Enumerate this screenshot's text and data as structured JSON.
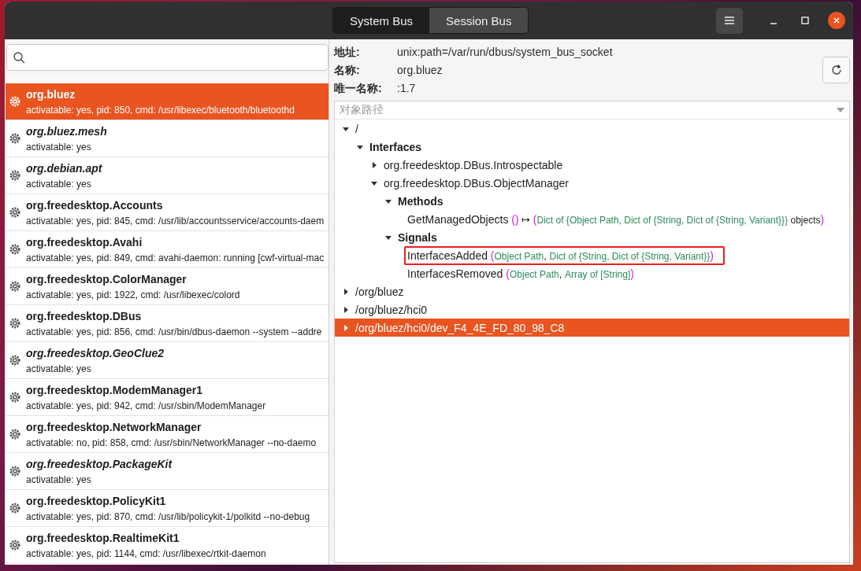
{
  "header": {
    "tabs": [
      {
        "label": "System Bus",
        "selected": true
      },
      {
        "label": "Session Bus",
        "selected": false
      }
    ]
  },
  "services": [
    {
      "name": "org.bluez",
      "detail": "activatable: yes, pid: 850, cmd: /usr/libexec/bluetooth/bluetoothd",
      "italic": false,
      "selected": true
    },
    {
      "name": "org.bluez.mesh",
      "detail": "activatable: yes",
      "italic": true,
      "selected": false
    },
    {
      "name": "org.debian.apt",
      "detail": "activatable: yes",
      "italic": true,
      "selected": false
    },
    {
      "name": "org.freedesktop.Accounts",
      "detail": "activatable: yes, pid: 845, cmd: /usr/lib/accountsservice/accounts-daem",
      "italic": false,
      "selected": false
    },
    {
      "name": "org.freedesktop.Avahi",
      "detail": "activatable: yes, pid: 849, cmd: avahi-daemon: running [cwf-virtual-mac",
      "italic": false,
      "selected": false
    },
    {
      "name": "org.freedesktop.ColorManager",
      "detail": "activatable: yes, pid: 1922, cmd: /usr/libexec/colord",
      "italic": false,
      "selected": false
    },
    {
      "name": "org.freedesktop.DBus",
      "detail": "activatable: yes, pid: 856, cmd: /usr/bin/dbus-daemon --system --addre",
      "italic": false,
      "selected": false
    },
    {
      "name": "org.freedesktop.GeoClue2",
      "detail": "activatable: yes",
      "italic": true,
      "selected": false
    },
    {
      "name": "org.freedesktop.ModemManager1",
      "detail": "activatable: yes, pid: 942, cmd: /usr/sbin/ModemManager",
      "italic": false,
      "selected": false
    },
    {
      "name": "org.freedesktop.NetworkManager",
      "detail": "activatable: no, pid: 858, cmd: /usr/sbin/NetworkManager --no-daemo",
      "italic": false,
      "selected": false
    },
    {
      "name": "org.freedesktop.PackageKit",
      "detail": "activatable: yes",
      "italic": true,
      "selected": false
    },
    {
      "name": "org.freedesktop.PolicyKit1",
      "detail": "activatable: yes, pid: 870, cmd: /usr/lib/policykit-1/polkitd --no-debug",
      "italic": false,
      "selected": false
    },
    {
      "name": "org.freedesktop.RealtimeKit1",
      "detail": "activatable: yes, pid: 1144, cmd: /usr/libexec/rtkit-daemon",
      "italic": false,
      "selected": false
    }
  ],
  "info": [
    {
      "label": "地址:",
      "value": "unix:path=/var/run/dbus/system_bus_socket"
    },
    {
      "label": "名称:",
      "value": "org.bluez"
    },
    {
      "label": "唯一名称:",
      "value": ":1.7"
    }
  ],
  "object_path": {
    "placeholder": "对象路径"
  },
  "tree": [
    {
      "label": "/",
      "bold": false,
      "expanded": true,
      "selected": false,
      "children": [
        {
          "label": "Interfaces",
          "bold": true,
          "expanded": true,
          "selected": false,
          "children": [
            {
              "label": "org.freedesktop.DBus.Introspectable",
              "bold": false,
              "expanded": false,
              "selected": false
            },
            {
              "label": "org.freedesktop.DBus.ObjectManager",
              "bold": false,
              "expanded": true,
              "selected": false,
              "children": [
                {
                  "label": "Methods",
                  "bold": true,
                  "expanded": true,
                  "selected": false,
                  "children": [
                    {
                      "kind": "member",
                      "highlighted": false,
                      "tokens": [
                        {
                          "kind": "name",
                          "text": "GetManagedObjects "
                        },
                        {
                          "kind": "paren",
                          "text": "()"
                        },
                        {
                          "kind": "plain",
                          "text": " ↦ "
                        },
                        {
                          "kind": "paren",
                          "text": "("
                        },
                        {
                          "kind": "type",
                          "text": "Dict of {Object Path, Dict of {String, Dict of {String, Variant}}}"
                        },
                        {
                          "kind": "arg",
                          "text": " objects"
                        },
                        {
                          "kind": "paren",
                          "text": ")"
                        }
                      ]
                    }
                  ]
                },
                {
                  "label": "Signals",
                  "bold": true,
                  "expanded": true,
                  "selected": false,
                  "children": [
                    {
                      "kind": "member",
                      "highlighted": true,
                      "tokens": [
                        {
                          "kind": "name",
                          "text": "InterfacesAdded "
                        },
                        {
                          "kind": "paren",
                          "text": "("
                        },
                        {
                          "kind": "type",
                          "text": "Object Path"
                        },
                        {
                          "kind": "plain",
                          "text": ", "
                        },
                        {
                          "kind": "type",
                          "text": "Dict of {String, Dict of {String, Variant}}"
                        },
                        {
                          "kind": "paren",
                          "text": ")"
                        }
                      ]
                    },
                    {
                      "kind": "member",
                      "highlighted": false,
                      "tokens": [
                        {
                          "kind": "name",
                          "text": "InterfacesRemoved "
                        },
                        {
                          "kind": "paren",
                          "text": "("
                        },
                        {
                          "kind": "type",
                          "text": "Object Path"
                        },
                        {
                          "kind": "plain",
                          "text": ", "
                        },
                        {
                          "kind": "type",
                          "text": "Array of [String]"
                        },
                        {
                          "kind": "paren",
                          "text": ")"
                        }
                      ]
                    }
                  ]
                }
              ]
            }
          ]
        }
      ]
    },
    {
      "label": "/org/bluez",
      "bold": false,
      "expanded": false,
      "selected": false
    },
    {
      "label": "/org/bluez/hci0",
      "bold": false,
      "expanded": false,
      "selected": false
    },
    {
      "label": "/org/bluez/hci0/dev_F4_4E_FD_80_98_C8",
      "bold": false,
      "expanded": false,
      "selected": true
    }
  ]
}
